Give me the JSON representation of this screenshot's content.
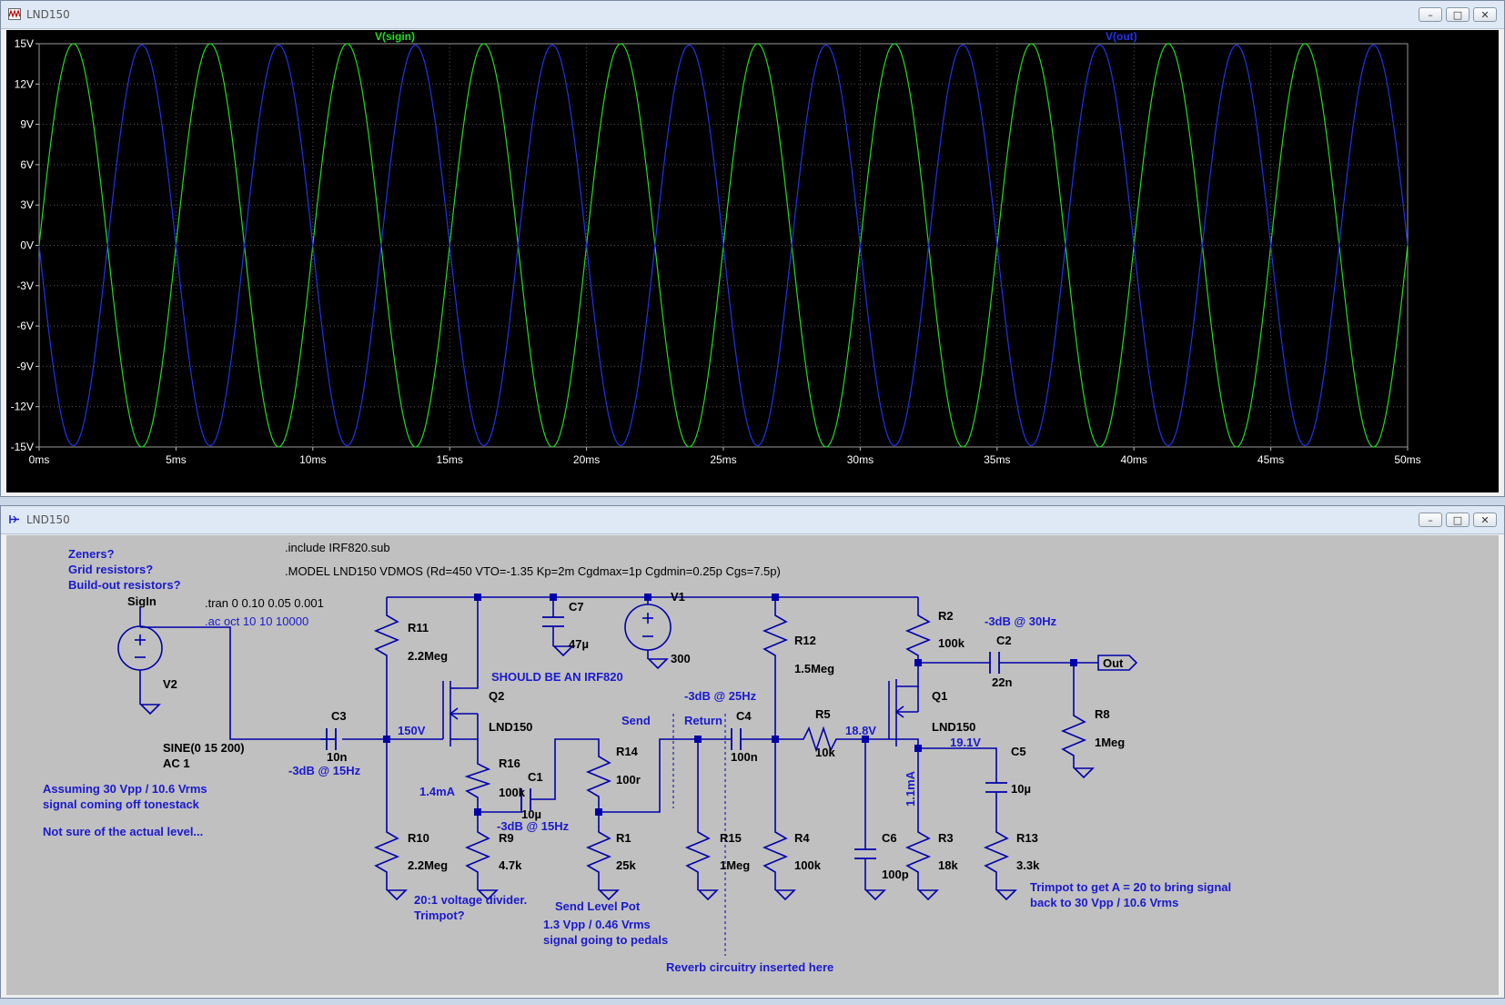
{
  "plot_window": {
    "title": "LND150",
    "buttons": {
      "minimize": "–",
      "maximize": "□",
      "close": "✕"
    }
  },
  "chart_data": {
    "type": "line",
    "title": "",
    "xlabel": "",
    "ylabel": "",
    "x_ticks": [
      "0ms",
      "5ms",
      "10ms",
      "15ms",
      "20ms",
      "25ms",
      "30ms",
      "35ms",
      "40ms",
      "45ms",
      "50ms"
    ],
    "y_ticks": [
      "15V",
      "12V",
      "9V",
      "6V",
      "3V",
      "0V",
      "-3V",
      "-6V",
      "-9V",
      "-12V",
      "-15V"
    ],
    "xlim": [
      0,
      50
    ],
    "ylim": [
      -15,
      15
    ],
    "x_unit": "ms",
    "y_unit": "V",
    "background": "#000000",
    "series": [
      {
        "name": "V(sigin)",
        "color": "#22dd22",
        "amplitude": 15,
        "frequency_hz": 200,
        "phase_deg": 0
      },
      {
        "name": "V(out)",
        "color": "#2233ee",
        "amplitude": 14.9,
        "frequency_hz": 200,
        "phase_deg": 180
      }
    ]
  },
  "schematic_window": {
    "title": "LND150",
    "buttons": {
      "minimize": "–",
      "maximize": "□",
      "close": "✕"
    }
  },
  "schematic": {
    "directives": {
      "include": ".include IRF820.sub",
      "model": ".MODEL LND150 VDMOS (Rd=450 VTO=-1.35 Kp=2m Cgdmax=1p Cgdmin=0.25p Cgs=7.5p)",
      "tran": ".tran 0 0.10 0.05 0.001",
      "ac": ".ac oct 10 10 10000"
    },
    "notes": {
      "questions": [
        "Zeners?",
        "Grid resistors?",
        "Build-out resistors?"
      ],
      "assuming": [
        "Assuming 30 Vpp / 10.6 Vrms",
        "signal coming off tonestack"
      ],
      "not_sure": "Not sure of the actual level...",
      "should_be": "SHOULD BE AN IRF820",
      "divider": [
        "20:1 voltage divider.",
        "Trimpot?"
      ],
      "send_level": [
        "Send Level Pot",
        "1.3 Vpp / 0.46 Vrms",
        "signal going to pedals"
      ],
      "reverb": "Reverb circuitry inserted here",
      "trimpot": [
        "Trimpot to get A = 20 to bring signal",
        "back to 30 Vpp / 10.6 Vrms"
      ],
      "db_c3": "-3dB @ 15Hz",
      "db_c1": "-3dB @ 15Hz",
      "db_c4": "-3dB @ 25Hz",
      "db_c2": "-3dB @ 30Hz"
    },
    "nets": {
      "sigin": "SigIn",
      "out": "Out",
      "send": "Send",
      "return": "Return"
    },
    "op_labels": {
      "v150": "150V",
      "v188": "18.8V",
      "v191": "19.1V",
      "i14": "1.4mA",
      "i11": "1.1mA"
    },
    "components": {
      "V2": {
        "name": "V2",
        "value": "SINE(0 15 200)",
        "value2": "AC 1"
      },
      "V1": {
        "name": "V1",
        "value": "300"
      },
      "C3": {
        "name": "C3",
        "value": "10n"
      },
      "C7": {
        "name": "C7",
        "value": "47µ"
      },
      "C1": {
        "name": "C1",
        "value": "10µ"
      },
      "C4": {
        "name": "C4",
        "value": "100n"
      },
      "C6": {
        "name": "C6",
        "value": "100p"
      },
      "C5": {
        "name": "C5",
        "value": "10µ"
      },
      "C2": {
        "name": "C2",
        "value": "22n"
      },
      "R11": {
        "name": "R11",
        "value": "2.2Meg"
      },
      "R10": {
        "name": "R10",
        "value": "2.2Meg"
      },
      "R16": {
        "name": "R16",
        "value": "100k"
      },
      "R9": {
        "name": "R9",
        "value": "4.7k"
      },
      "R14": {
        "name": "R14",
        "value": "100r"
      },
      "R1": {
        "name": "R1",
        "value": "25k"
      },
      "R15": {
        "name": "R15",
        "value": "1Meg"
      },
      "R12": {
        "name": "R12",
        "value": "1.5Meg"
      },
      "R4": {
        "name": "R4",
        "value": "100k"
      },
      "R5": {
        "name": "R5",
        "value": "10k"
      },
      "R2": {
        "name": "R2",
        "value": "100k"
      },
      "R3": {
        "name": "R3",
        "value": "18k"
      },
      "R13": {
        "name": "R13",
        "value": "3.3k"
      },
      "R8": {
        "name": "R8",
        "value": "1Meg"
      },
      "Q2": {
        "name": "Q2",
        "value": "LND150"
      },
      "Q1": {
        "name": "Q1",
        "value": "LND150"
      }
    },
    "colors": {
      "background": "#c0c0c0",
      "wire": "#0000aa",
      "text_black": "#000000",
      "text_blue": "#1a1acc"
    }
  }
}
